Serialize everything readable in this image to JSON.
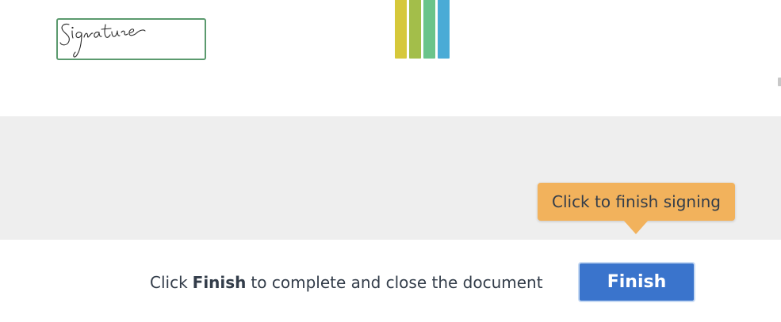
{
  "document": {
    "signature_field": {
      "signature_text": "Signature",
      "border_color": "#5b9a6e"
    },
    "logo": {
      "icon": "striped-bars-logo",
      "bar_colors": [
        "#d6c83a",
        "#a3be4a",
        "#6ac48a",
        "#4aabd6"
      ]
    }
  },
  "tooltip": {
    "text": "Click to finish signing",
    "color": "#f2b25c"
  },
  "footer": {
    "message_before": "Click",
    "message_bold": "Finish",
    "message_after": "to complete and close the document",
    "finish_button_label": "Finish",
    "button_color": "#3a74cc"
  }
}
